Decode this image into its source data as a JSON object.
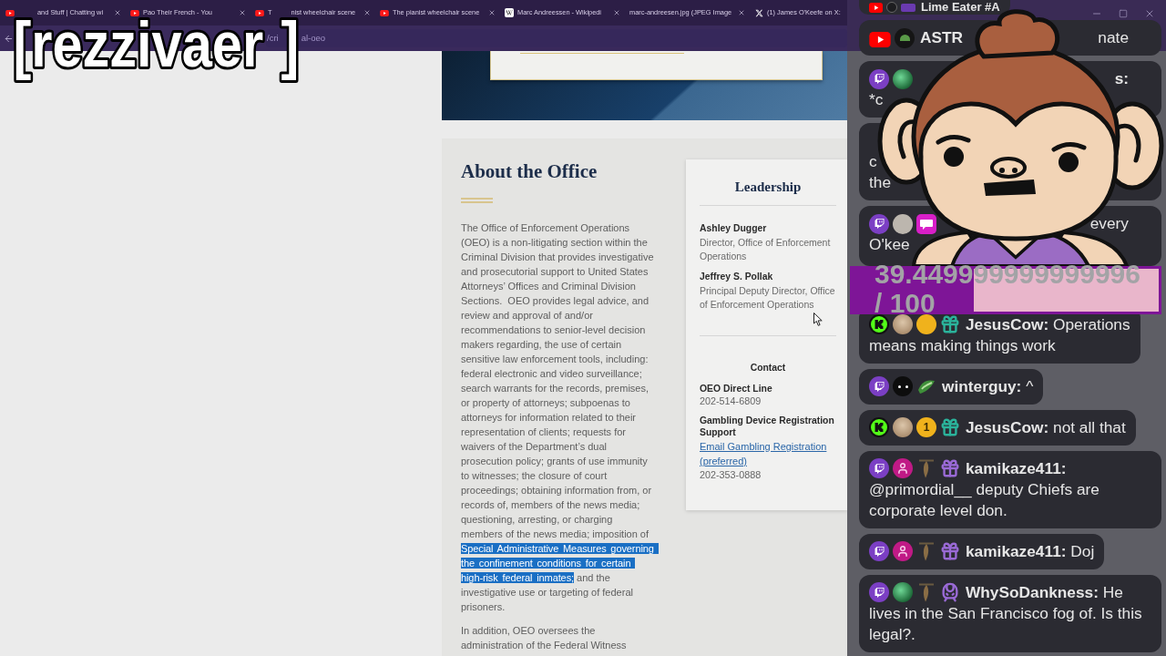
{
  "browser": {
    "tabs": [
      {
        "kind": "youtube",
        "lead_hidden": true,
        "label_parts": [
          "and Stuff | Chatting wi"
        ],
        "closable": true
      },
      {
        "kind": "youtube",
        "lead_hidden": false,
        "label_parts": [
          "Pao Their French - You"
        ],
        "closable": true
      },
      {
        "kind": "youtube",
        "lead_hidden": false,
        "label_parts": [
          "T",
          "nist wheelchair scene"
        ],
        "closable": true
      },
      {
        "kind": "youtube",
        "lead_hidden": false,
        "label_parts": [
          "The pianist wheelchair scene"
        ],
        "closable": true
      },
      {
        "kind": "wikipedia",
        "lead_hidden": false,
        "label_parts": [
          "Marc Andreessen - Wikipedi"
        ],
        "closable": true
      },
      {
        "kind": "plain",
        "lead_hidden": false,
        "label_parts": [
          "marc-andreesen.jpg (JPEG Image"
        ],
        "closable": true
      },
      {
        "kind": "x",
        "lead_hidden": false,
        "label_parts": [
          "(1) James O'Keefe on X:"
        ],
        "closable": false
      }
    ],
    "address_bar": {
      "url_parts": [
        "/cri",
        "al-oeo"
      ]
    },
    "window_controls": [
      {
        "kind": "minimize"
      },
      {
        "kind": "maximize"
      },
      {
        "kind": "close"
      }
    ]
  },
  "stream_overlay": {
    "name_tag": "[rezzivaer]"
  },
  "article": {
    "heading": "About the Office",
    "paragraphs": [
      {
        "segments": [
          {
            "text": "The Office of Enforcement Operations (OEO) is a non-litigating section within the Criminal Division that provides investigative and prosecutorial support to United States Attorneys’ Offices and Criminal Division Sections.  OEO provides legal advice, and review and approval of and/or recommendations to senior-level decision makers regarding, the use of certain sensitive law enforcement tools, including: federal electronic and video surveillance; search warrants for the records, premises, or property of attorneys; subpoenas to attorneys for information related to their representation of clients; requests for waivers of the Department’s dual prosecution policy; grants of use immunity to witnesses; the closure of court proceedings; obtaining information from, or records of, members of the news media; questioning, arresting, or charging members of the news media; imposition of ",
            "selected": false
          },
          {
            "text": "Special Administrative Measures governing the confinement conditions for certain high-risk federal inmates;",
            "selected": true
          },
          {
            "text": " and the investigative use or targeting of federal prisoners.",
            "selected": false
          }
        ]
      },
      {
        "segments": [
          {
            "text": "In addition, OEO oversees the administration of the Federal Witness",
            "selected": false
          }
        ]
      }
    ]
  },
  "leadership_card": {
    "title": "Leadership",
    "people": [
      {
        "name": "Ashley Dugger",
        "role": "Director, Office of Enforcement Operations"
      },
      {
        "name": "Jeffrey S. Pollak",
        "role": "Principal Deputy Director, Office of Enforcement Operations"
      }
    ],
    "contact_title": "Contact",
    "contacts": [
      {
        "label": "OEO Direct Line",
        "phone": "202-514-6809"
      },
      {
        "label": "Gambling Device Registration Support",
        "link": "Email Gambling Registration (preferred)",
        "phone": "202-353-0888"
      }
    ]
  },
  "chat": {
    "upper_messages": [
      {
        "kind": "cut",
        "badges": [
          {
            "kind": "youtube"
          },
          {
            "kind": "dark"
          },
          {
            "kind": "violet"
          }
        ],
        "head": {
          "left": {
            "kind": "user",
            "text": "Lime Eater #A"
          }
        }
      },
      {
        "kind": "covered",
        "badges": [
          {
            "kind": "youtube"
          },
          {
            "kind": "crest"
          }
        ],
        "head": {
          "left": {
            "kind": "user",
            "text": "ASTR"
          },
          "right": {
            "kind": "message",
            "text": "nate"
          }
        }
      },
      {
        "kind": "covered",
        "badges": [
          {
            "kind": "twitch"
          },
          {
            "kind": "gem"
          }
        ],
        "head": {
          "right": {
            "kind": "user",
            "text": "s:"
          }
        },
        "lines": [
          "*c"
        ]
      },
      {
        "kind": "covered",
        "lines": [
          "c",
          "the"
        ]
      },
      {
        "kind": "covered",
        "badges": [
          {
            "kind": "twitch"
          },
          {
            "kind": "person"
          },
          {
            "kind": "pink"
          }
        ],
        "head": {
          "right": {
            "kind": "message",
            "text": "every"
          }
        },
        "lines": [
          "O'kee"
        ]
      }
    ],
    "goal_bar": {
      "reading": "39.449999999999996 / 100",
      "level": 0.3945
    },
    "lower_messages": [
      {
        "badges": [
          {
            "kind": "kick"
          },
          {
            "kind": "cat"
          },
          {
            "kind": "tier"
          },
          {
            "kind": "gift",
            "color": "#2bb39b"
          }
        ],
        "user": "JesusCow:",
        "text_lines": [
          "Operations",
          "means making things work"
        ]
      },
      {
        "badges": [
          {
            "kind": "twitch"
          },
          {
            "kind": "blob"
          },
          {
            "kind": "moss"
          }
        ],
        "user": "winterguy:",
        "text_lines": [
          "^"
        ]
      },
      {
        "badges": [
          {
            "kind": "kick"
          },
          {
            "kind": "cat"
          },
          {
            "kind": "tier",
            "label": "1"
          },
          {
            "kind": "gift",
            "color": "#2bb39b"
          }
        ],
        "user": "JesusCow:",
        "text_lines": [
          "not all that"
        ]
      },
      {
        "badges": [
          {
            "kind": "twitch"
          },
          {
            "kind": "user"
          },
          {
            "kind": "feather"
          },
          {
            "kind": "gift",
            "color": "#9a6ad6"
          }
        ],
        "user": "kamikaze411:",
        "text_lines": [
          "@primordial__ deputy Chiefs are corporate level don."
        ]
      },
      {
        "badges": [
          {
            "kind": "twitch"
          },
          {
            "kind": "user"
          },
          {
            "kind": "feather"
          },
          {
            "kind": "gift",
            "color": "#9a6ad6"
          }
        ],
        "user": "kamikaze411:",
        "text_lines": [
          "Doj"
        ]
      },
      {
        "badges": [
          {
            "kind": "twitch"
          },
          {
            "kind": "gem"
          },
          {
            "kind": "feather"
          },
          {
            "kind": "tram"
          }
        ],
        "user": "WhySoDankness:",
        "text_lines": [
          "He",
          "lives in the San Francisco fog of. Is this legal?."
        ]
      }
    ]
  }
}
